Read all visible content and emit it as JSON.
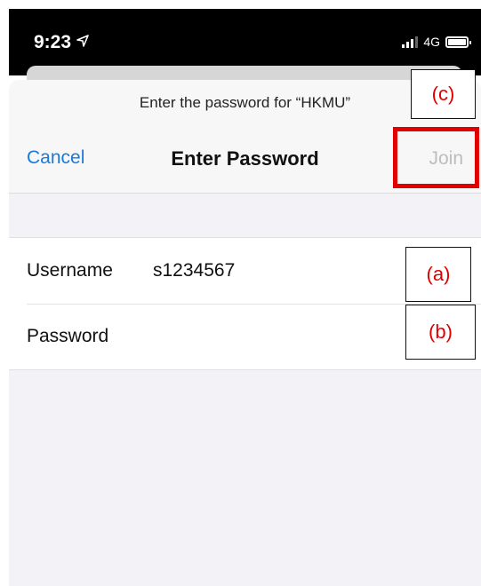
{
  "status_bar": {
    "time": "9:23",
    "location_icon": "location-arrow-icon",
    "network": "4G",
    "signal_icon": "cellular-signal-icon",
    "battery_icon": "battery-icon"
  },
  "sheet": {
    "prompt": "Enter the password for “HKMU”",
    "cancel_label": "Cancel",
    "title": "Enter Password",
    "join_label": "Join"
  },
  "form": {
    "username": {
      "label": "Username",
      "value": "s1234567"
    },
    "password": {
      "label": "Password",
      "value": ""
    }
  },
  "annotations": {
    "a": "(a)",
    "b": "(b)",
    "c": "(c)",
    "highlight_color": "#e00000"
  },
  "colors": {
    "link": "#1b7ad8",
    "disabled": "#bdbdbd"
  }
}
